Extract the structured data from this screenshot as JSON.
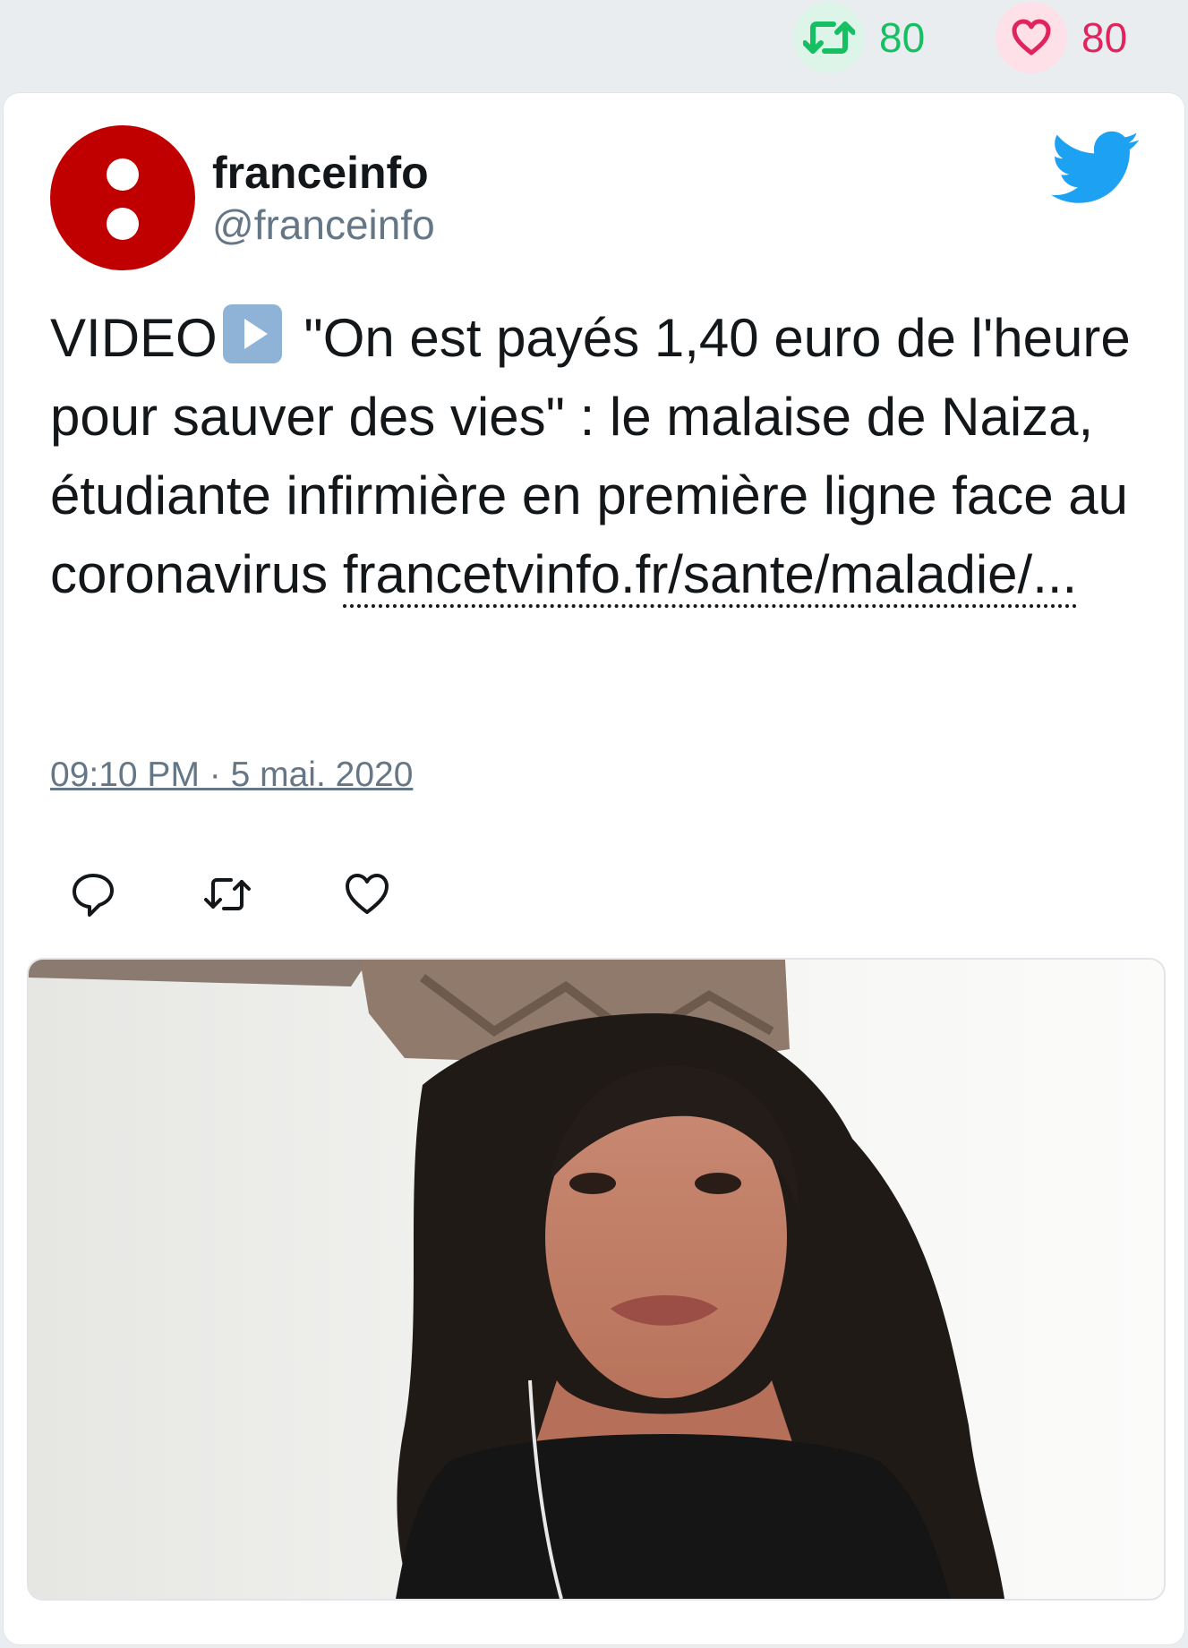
{
  "stats": {
    "retweets": "80",
    "likes": "80"
  },
  "tweet": {
    "display_name": "franceinfo",
    "handle": "@franceinfo",
    "text_before_icon": "VIDEO",
    "text_after_icon": " \"On est payés 1,40 euro de l'heure pour sauver des vies\" : le malaise de Naiza, étudiante infirmière en première ligne face au coronavirus ",
    "link_text": "francetvinfo.fr/sante/maladie/...",
    "timestamp": "09:10 PM · 5 mai. 2020"
  },
  "icons": {
    "retweet_stat": "retweet-icon",
    "like_stat": "heart-icon",
    "avatar": "franceinfo-logo",
    "brand": "twitter-bird-icon",
    "play": "play-button-emoji",
    "reply": "reply-icon",
    "retweet": "retweet-icon",
    "like": "heart-icon"
  },
  "colors": {
    "retweet_green": "#17bf63",
    "like_red": "#e0245e",
    "twitter_blue": "#1da1f2",
    "avatar_red": "#c00000"
  }
}
